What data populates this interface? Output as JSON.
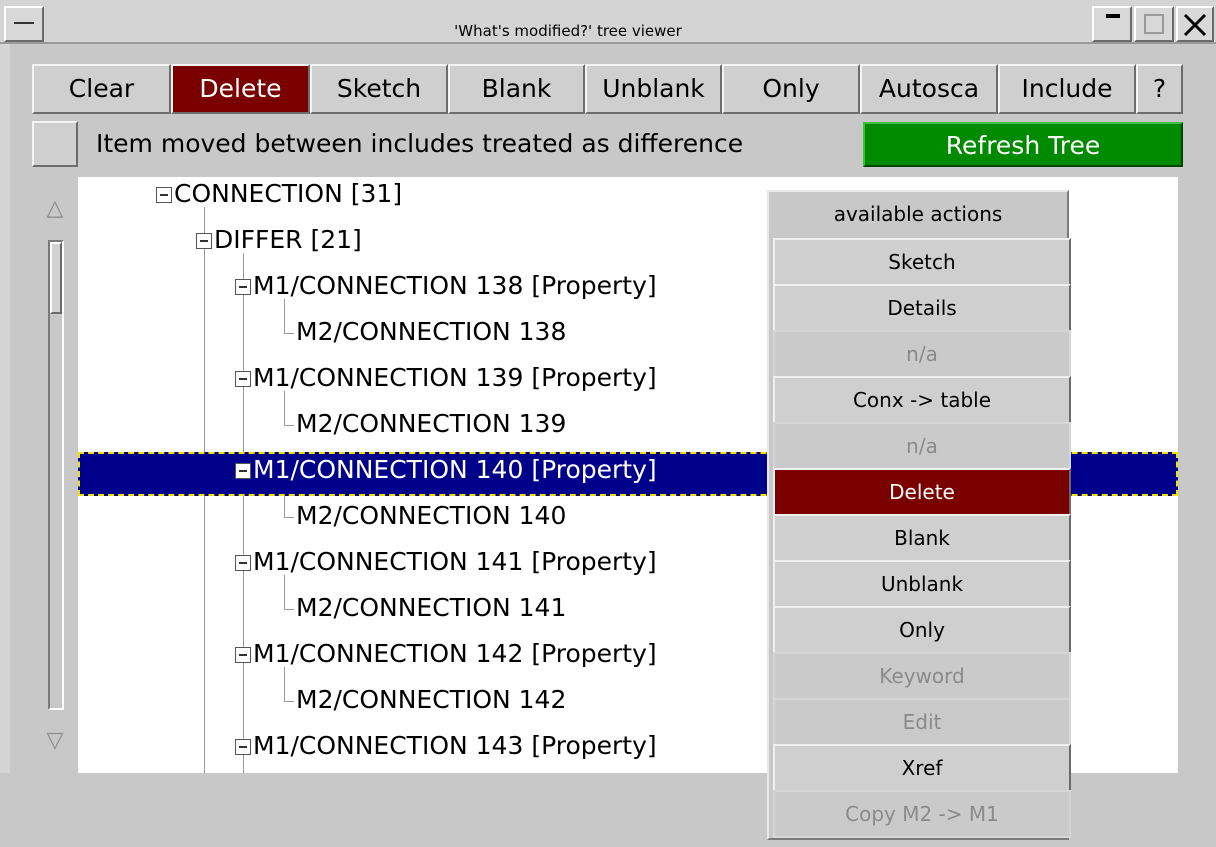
{
  "window": {
    "title": "'What's modified?' tree viewer"
  },
  "toolbar": [
    {
      "key": "clear",
      "label": "Clear"
    },
    {
      "key": "delete",
      "label": "Delete"
    },
    {
      "key": "sketch",
      "label": "Sketch"
    },
    {
      "key": "blank",
      "label": "Blank"
    },
    {
      "key": "unblank",
      "label": "Unblank"
    },
    {
      "key": "only",
      "label": "Only"
    },
    {
      "key": "autosca",
      "label": "Autosca"
    },
    {
      "key": "include",
      "label": "Include"
    },
    {
      "key": "help",
      "label": "?"
    }
  ],
  "options": {
    "include_move_label": "Item moved between includes treated as difference",
    "refresh_label": "Refresh Tree"
  },
  "tree": [
    {
      "label": "CONNECTION [31]"
    },
    {
      "label": "DIFFER [21]"
    },
    {
      "label": "M1/CONNECTION 138 [Property]"
    },
    {
      "label": "M2/CONNECTION 138"
    },
    {
      "label": "M1/CONNECTION 139 [Property]"
    },
    {
      "label": "M2/CONNECTION 139"
    },
    {
      "label": "M1/CONNECTION 140 [Property]"
    },
    {
      "label": "M2/CONNECTION 140"
    },
    {
      "label": "M1/CONNECTION 141 [Property]"
    },
    {
      "label": "M2/CONNECTION 141"
    },
    {
      "label": "M1/CONNECTION 142 [Property]"
    },
    {
      "label": "M2/CONNECTION 142"
    },
    {
      "label": "M1/CONNECTION 143 [Property]"
    }
  ],
  "menu": {
    "title": "available actions",
    "items": [
      {
        "label": "Sketch"
      },
      {
        "label": "Details"
      },
      {
        "label": "n/a"
      },
      {
        "label": "Conx -> table"
      },
      {
        "label": "n/a"
      },
      {
        "label": "Delete"
      },
      {
        "label": "Blank"
      },
      {
        "label": "Unblank"
      },
      {
        "label": "Only"
      },
      {
        "label": "Keyword"
      },
      {
        "label": "Edit"
      },
      {
        "label": "Xref"
      },
      {
        "label": "Copy M2 -> M1"
      }
    ]
  },
  "colors": {
    "danger": "#7a0000",
    "refresh": "#008a00",
    "selection": "#00008a"
  }
}
